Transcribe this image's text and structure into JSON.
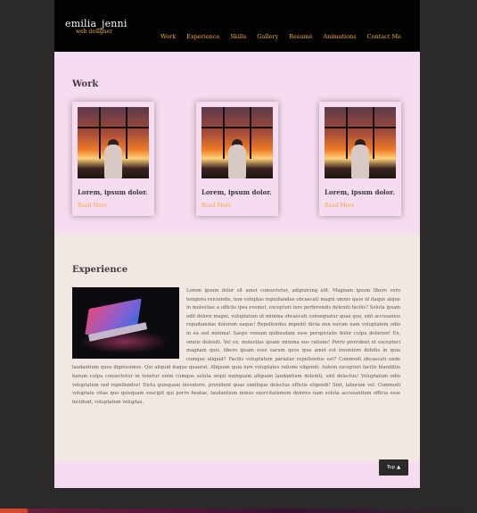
{
  "header": {
    "logo_name": "emilia_jenni",
    "logo_sub": "web designer",
    "nav": [
      "Work",
      "Experience",
      "Skills",
      "Gallery",
      "Resumé",
      "Animations",
      "Contact Me"
    ]
  },
  "work": {
    "title": "Work",
    "cards": [
      {
        "title": "Lorem, ipsum dolor.",
        "link": "Read More"
      },
      {
        "title": "Lorem, ipsum dolor.",
        "link": "Read More"
      },
      {
        "title": "Lorem, ipsum dolor.",
        "link": "Read More"
      }
    ]
  },
  "experience": {
    "title": "Experience",
    "text": "Lorem ipsum dolor sit amet consectetur, adipisicing elit. Magnam ipsum libero vero tempora reiciendis, non voluptas repudiandae obcaecati magni omnis quos id itaque atque in molestiae a officiis ipsa eveniet, excepturi iure perferendis deleniti facilis? Soluta ipsam odit dolore magni, voluptatum ut minima obcaecati consequatur quae quo, sint accusamus repudiandae dolorem eaque! Repellendus impedit dicta non earum nam voluptatem odio in ea sed minima! Saepe veniam quibusdam esse perspiciatis dolor culpa dolorum! Ex, omnis deleniti. Vel ex, molestias ipsam minima eos ratione! Porro provident et excepturi magnam quis, libero ipsam esse earum quos ipsa amet est inventore debitis in quia cumque aliquid? Facilis voluptatem pariatur repellendus est? Commodi obcaecati unde laudantium quos dignissimos. Qui aliquid itaque quaerat. Aliquam quia iure voluptates ratione eligendi. Autem excepturi facilis blanditiis harum culpa consectetur in tenetur enim cumque soluta sequi numquam aliquam laudantium deleniti, sint delectus! Voluptatum odio voluptatem sed repellendus! Dicta quisquam inventore, provident quas similique delectus officiis eligendi! Sint, laborum vel. Commodi voluptate vitae quo quisquam suscipit qui porro beatae, laudantium minus exercitationem dolores nam soluta accusantium officia esse incidunt, voluptatem voluptas."
  },
  "top_button": {
    "label": "Top"
  },
  "colors": {
    "accent": "#f0a93a",
    "header_bg": "#030303",
    "page_bg": "#f6dcf0",
    "exp_bg": "#f1e9e1"
  }
}
